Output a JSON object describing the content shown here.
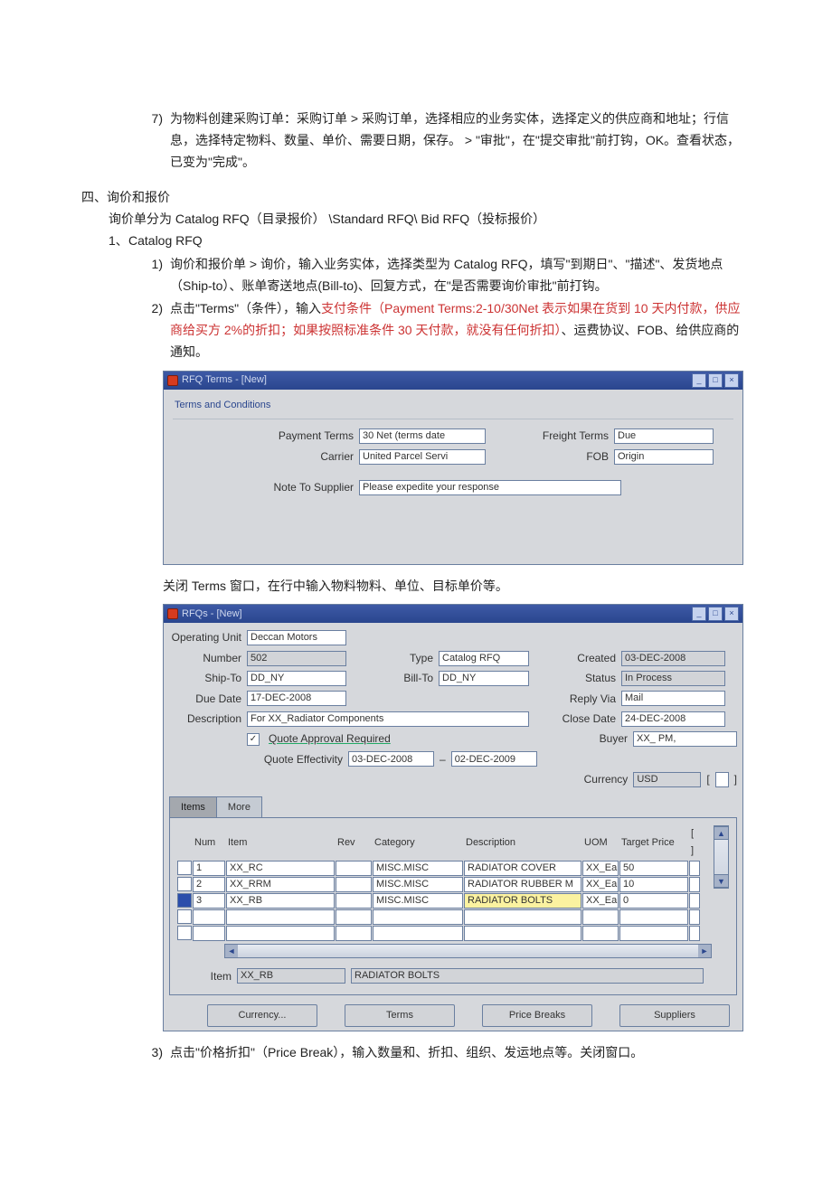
{
  "doc": {
    "step7_marker": "7)",
    "step7_text": "为物料创建采购订单：采购订单 > 采购订单，选择相应的业务实体，选择定义的供应商和地址；行信息，选择特定物料、数量、单价、需要日期，保存。 > \"审批\"，在\"提交审批\"前打钩，OK。查看状态，已变为\"完成\"。",
    "section4": "四、询价和报价",
    "section4_intro": "询价单分为 Catalog RFQ（目录报价）  \\Standard RFQ\\ Bid RFQ（投标报价）",
    "catalog_marker": "1、",
    "catalog_title": "Catalog RFQ",
    "step1_marker": "1)",
    "step1_text": "询价和报价单 > 询价，输入业务实体，选择类型为 Catalog RFQ，填写\"到期日\"、\"描述\"、发货地点（Ship-to）、账单寄送地点(Bill-to)、回复方式，在\"是否需要询价审批\"前打钩。",
    "step2_marker": "2)",
    "step2_pre": "点击\"Terms\"（条件），输入",
    "step2_red": "支付条件（Payment Terms:2-10/30Net 表示如果在货到 10 天内付款，供应商给买方 2%的折扣；如果按照标准条件 30 天付款，就没有任何折扣）",
    "step2_post": "、运费协议、FOB、给供应商的通知。",
    "close_terms": "关闭 Terms 窗口，在行中输入物料物料、单位、目标单价等。",
    "step3_marker": "3)",
    "step3_text": "点击\"价格折扣\"（Price Break），输入数量和、折扣、组织、发运地点等。关闭窗口。"
  },
  "terms_window": {
    "title": "RFQ Terms - [New]",
    "fieldset": "Terms and Conditions",
    "labels": {
      "payment": "Payment Terms",
      "freight": "Freight Terms",
      "carrier": "Carrier",
      "fob": "FOB",
      "note": "Note To Supplier"
    },
    "values": {
      "payment": "30 Net (terms date",
      "freight": "Due",
      "carrier": "United Parcel Servi",
      "fob": "Origin",
      "note": "Please expedite your response"
    }
  },
  "rfq_window": {
    "title": "RFQs - [New]",
    "labels": {
      "operating_unit": "Operating Unit",
      "number": "Number",
      "type": "Type",
      "created": "Created",
      "shipto": "Ship-To",
      "billto": "Bill-To",
      "status": "Status",
      "duedate": "Due Date",
      "replyvia": "Reply Via",
      "description": "Description",
      "closedate": "Close Date",
      "quote_approval": "Quote Approval Required",
      "buyer": "Buyer",
      "quote_eff": "Quote Effectivity",
      "dash": "–",
      "currency": "Currency",
      "item_btm": "Item"
    },
    "values": {
      "operating_unit": "Deccan Motors",
      "number": "502",
      "type": "Catalog RFQ",
      "created": "03-DEC-2008",
      "shipto": "DD_NY",
      "billto": "DD_NY",
      "status": "In Process",
      "duedate": "17-DEC-2008",
      "replyvia": "Mail",
      "description": "For XX_Radiator Components",
      "closedate": "24-DEC-2008",
      "buyer": "XX_ PM,",
      "quote_eff_from": "03-DEC-2008",
      "quote_eff_to": "02-DEC-2009",
      "currency": "USD",
      "item_btm": "XX_RB",
      "item_btm_desc": "RADIATOR BOLTS"
    },
    "tabs": {
      "items": "Items",
      "more": "More"
    },
    "grid": {
      "headers": {
        "num": "Num",
        "item": "Item",
        "rev": "Rev",
        "category": "Category",
        "description": "Description",
        "uom": "UOM",
        "target_price": "Target Price"
      },
      "rows": [
        {
          "num": "1",
          "item": "XX_RC",
          "rev": "",
          "cat": "MISC.MISC",
          "desc": "RADIATOR COVER",
          "uom": "XX_Ea",
          "tp": "50"
        },
        {
          "num": "2",
          "item": "XX_RRM",
          "rev": "",
          "cat": "MISC.MISC",
          "desc": "RADIATOR RUBBER M",
          "uom": "XX_Ea",
          "tp": "10"
        },
        {
          "num": "3",
          "item": "XX_RB",
          "rev": "",
          "cat": "MISC.MISC",
          "desc": "RADIATOR BOLTS",
          "uom": "XX_Ea",
          "tp": "0"
        }
      ]
    },
    "buttons": {
      "currency": "Currency...",
      "terms": "Terms",
      "price_breaks": "Price Breaks",
      "suppliers": "Suppliers"
    }
  }
}
